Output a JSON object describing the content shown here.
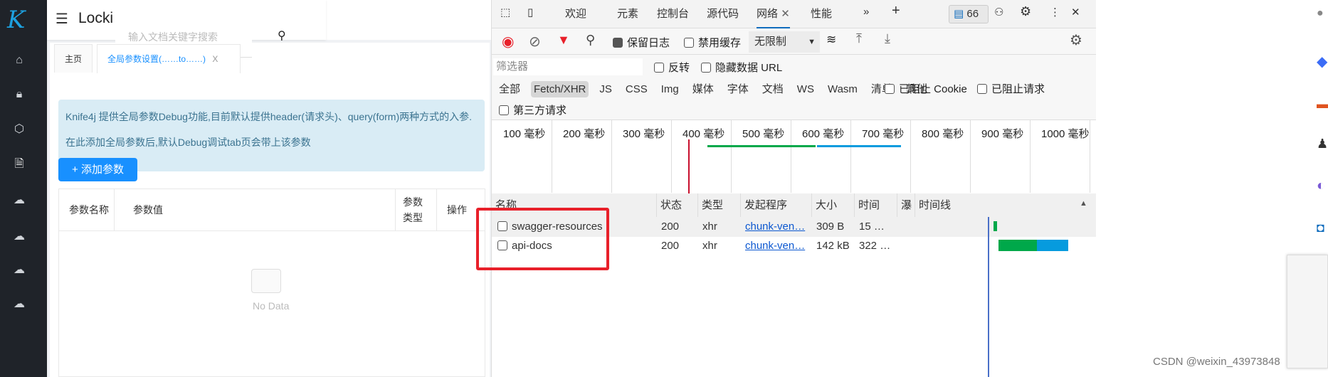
{
  "app": {
    "logo": "K",
    "title": "Locki",
    "search_placeholder": "输入文档关键字搜索"
  },
  "sidebar": {
    "items": [
      "home-icon",
      "lock-icon",
      "cube-icon",
      "doc-settings-icon",
      "api-cloud-icon",
      "api-cloud-icon",
      "api-cloud-icon",
      "api-cloud-icon"
    ]
  },
  "tabs": [
    {
      "label": "主页"
    },
    {
      "label": "全局参数设置(……to……)",
      "close": "X"
    }
  ],
  "info": {
    "line1": "Knife4j 提供全局参数Debug功能,目前默认提供header(请求头)、query(form)两种方式的入参.",
    "line2": "在此添加全局参数后,默认Debug调试tab页会带上该参数"
  },
  "add_button": {
    "icon": "+",
    "label": "添加参数"
  },
  "table": {
    "headers": [
      "参数名称",
      "参数值",
      "参数类型",
      "操作"
    ],
    "empty": "No Data"
  },
  "devtools": {
    "tabs": [
      "欢迎",
      "元素",
      "控制台",
      "源代码",
      "网络",
      "性能"
    ],
    "active_tab": "网络",
    "issues_count": "66",
    "toolbar": {
      "preserve_log": "保留日志",
      "preserve_log_checked": true,
      "disable_cache": "禁用缓存",
      "throttle": "无限制"
    },
    "filter": {
      "placeholder": "筛选器",
      "invert": "反转",
      "hide_data_urls": "隐藏数据 URL"
    },
    "types": [
      "全部",
      "Fetch/XHR",
      "JS",
      "CSS",
      "Img",
      "媒体",
      "字体",
      "文档",
      "WS",
      "Wasm",
      "清单",
      "其他"
    ],
    "active_type": "Fetch/XHR",
    "blocked_cookies": "已阻止 Cookie",
    "blocked_requests": "已阻止请求",
    "third_party": "第三方请求",
    "timeline_ticks": [
      "100  毫秒",
      "200  毫秒",
      "300  毫秒",
      "400  毫秒",
      "500  毫秒",
      "600  毫秒",
      "700  毫秒",
      "800  毫秒",
      "900  毫秒",
      "1000  毫秒"
    ],
    "columns": [
      "名称",
      "状态",
      "类型",
      "发起程序",
      "大小",
      "时间",
      "瀑",
      "时间线"
    ],
    "rows": [
      {
        "name": "swagger-resources",
        "status": "200",
        "type": "xhr",
        "initiator": "chunk-ven…",
        "size": "309 B",
        "time": "15  …"
      },
      {
        "name": "api-docs",
        "status": "200",
        "type": "xhr",
        "initiator": "chunk-ven…",
        "size": "142 kB",
        "time": "322  …"
      }
    ],
    "colors": {
      "waiting": "#00a84a",
      "download": "#069bde",
      "highlight": "#e8202a"
    }
  },
  "watermark": "CSDN @weixin_43973848"
}
